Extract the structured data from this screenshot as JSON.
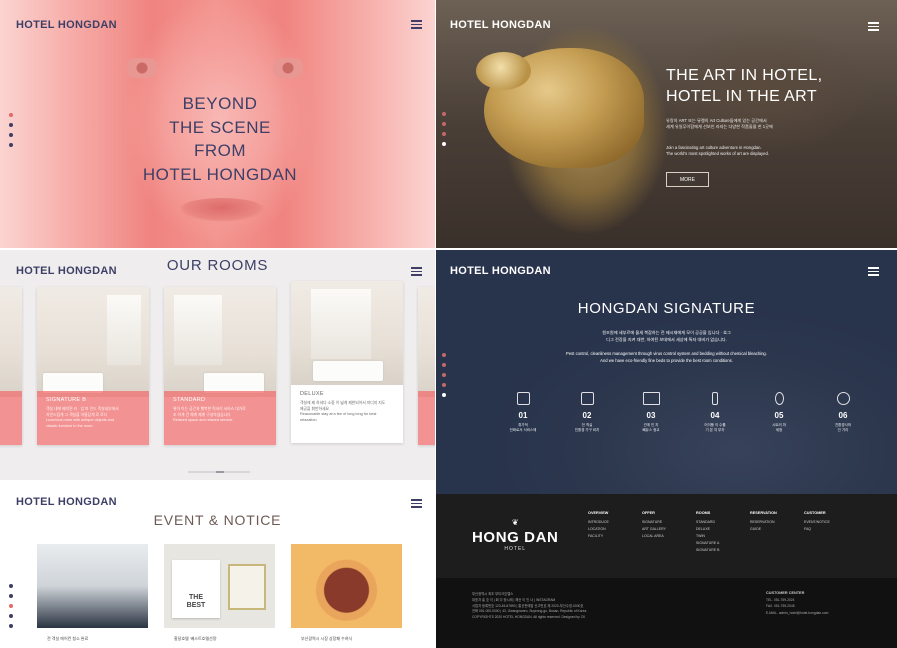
{
  "brand": "HOTEL HONGDAN",
  "panel1": {
    "title_lines": [
      "BEYOND",
      "THE SCENE",
      "FROM",
      "HOTEL HONGDAN"
    ]
  },
  "panel2": {
    "title_lines": [
      "THE ART IN HOTEL,",
      "HOTEL IN THE ART"
    ],
    "ko_text": [
      "유랑의 ART 또는 뮤랭의 Art Culture들에게 있는 공간에서",
      "세계 유일무이함에게 선보인 라자는 다양한 작품들을 한 1곳에"
    ],
    "en_text": [
      "Join a fascinating art culture adventure in Hongdan.",
      "The world's most spotlighted works of art are displayed."
    ],
    "more_label": "MORE"
  },
  "rooms": {
    "section_title": "OUR ROOMS",
    "items": [
      {
        "name": "SIGNATURE B",
        "desc": [
          "객실 내에 배치된 라 · 업 파 인드 객실내부에서",
          "자연스럽게 그 객실을 아름답게 로 로다",
          "Luxurious room with antique objects and",
          "classic furniture in the room."
        ]
      },
      {
        "name": "STANDARD",
        "desc": [
          "위아 이는 공간과 행복한 럭셔리 서비스 대가로",
          "조 하게 건 체계 제계 구성하셨습니다",
          "Relaxed space and relaxed service."
        ]
      },
      {
        "name": "DELUXE",
        "desc": [
          "객실에 제 하셔다 소중 이 넓게 제한되어서 미디지 지도",
          "제공을 휘만하세요",
          "Reasonable stay at a fee of long long for best",
          "relaxation."
        ]
      }
    ]
  },
  "signature": {
    "section_title": "HONGDAN SIGNATURE",
    "ko_text": [
      "원조원에 세부르에 물새 복잡하는 전 제시재에게 모이 공공을 입니다 · 호그",
      "디그 전장을 지켜 대반, 하여된 보데에서 세상에 특자 대비가 없습니다."
    ],
    "en_text": [
      "Pest control, cleanliness management through virus control system and bedding without chemical bleaching.",
      "And we have eco-friendly fine beds to provide the best room conditions."
    ],
    "features": [
      {
        "no": "01",
        "label": [
          "휴가적",
          "전화로서 서비스에"
        ]
      },
      {
        "no": "02",
        "label": [
          "전 객실",
          "친환경 가구 비치"
        ]
      },
      {
        "no": "03",
        "label": [
          "관계 인 지",
          "빼유스 정교"
        ]
      },
      {
        "no": "04",
        "label": [
          "어이풍 이 수를",
          "기 본 지 부자"
        ]
      },
      {
        "no": "05",
        "label": [
          "시트러 마",
          "세정"
        ]
      },
      {
        "no": "06",
        "label": [
          "친환경사하",
          "인 기리"
        ]
      }
    ]
  },
  "event": {
    "section_title": "EVENT & NOTICE",
    "items": [
      {
        "caption": "전 객실 에어컨 청소 완료"
      },
      {
        "caption": "홍달호텔 '베스트호텔선정'"
      },
      {
        "caption": "부산광역시 시장 상장패 수여식"
      }
    ],
    "best_text": [
      "THE",
      "BEST"
    ]
  },
  "footer": {
    "logo_main": "HONG DAN",
    "logo_sub": "HOTEL",
    "columns": [
      {
        "head": "OVERVIEW",
        "items": [
          "INTRODUCE",
          "LOCATION",
          "FACILITY"
        ]
      },
      {
        "head": "OFFER",
        "items": [
          "SIGNATURE",
          "ART GALLERY",
          "LOCAL AREA"
        ]
      },
      {
        "head": "ROOMS",
        "items": [
          "STANDARD",
          "DELUXE",
          "TWIN",
          "SIGNATURE A",
          "SIGNATURE B"
        ]
      },
      {
        "head": "RESERVATION",
        "items": [
          "RESERVATION",
          "GUIDE"
        ]
      },
      {
        "head": "CUSTOMER",
        "items": [
          "EVENT/NOTICE",
          "FAQ"
        ]
      }
    ],
    "info_lines": [
      "부산광역시 최초 부티크호텔스",
      "대표자 홍 호 이 | 회 다 정시제 | 해산 이 인 너 | INSTAGRAM",
      "사업자 등록번호 123-45-67890 | 통신판매업 신고번호 제 2020-부산수영-0000호",
      "전화 051-000-0000 | 43, Gwangnamro, Suyeong-gu, Busan, Republic of Korea",
      "COPYRIGHTS 2020 HOTEL HONGDAN. All rights reserved. Designed by CK"
    ],
    "customer_center": "CUSTOMER CENTER",
    "customer_lines": [
      "TEL. 051-759-2024",
      "FAX. 051-759-2045",
      "E-MAIL. admin_hotel@hotel-hongdan.com"
    ]
  },
  "colors": {
    "navy": "#3d3f66",
    "pink": "#f07373",
    "footer_bg": "#1d1d1d"
  }
}
